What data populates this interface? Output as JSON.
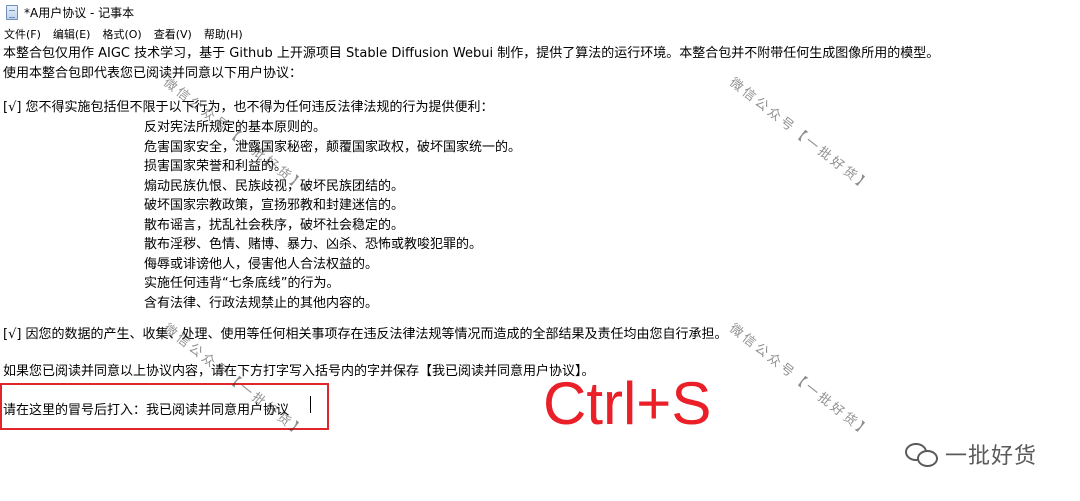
{
  "window": {
    "title": "*A用户协议 - 记事本"
  },
  "menu": [
    {
      "label": "文件(F)",
      "name": "file"
    },
    {
      "label": "编辑(E)",
      "name": "edit"
    },
    {
      "label": "格式(O)",
      "name": "format"
    },
    {
      "label": "查看(V)",
      "name": "view"
    },
    {
      "label": "帮助(H)",
      "name": "help"
    }
  ],
  "document": {
    "intro_1": "本整合包仅用作 AIGC 技术学习，基于 Github 上开源项目 Stable Diffusion Webui 制作，提供了算法的运行环境。本整合包并不附带任何生成图像所用的模型。",
    "intro_2": "使用本整合包即代表您已阅读并同意以下用户协议：",
    "clause_1_head": "[√] 您不得实施包括但不限于以下行为，也不得为任何违反法律法规的行为提供便利：",
    "clause_1_items": [
      "反对宪法所规定的基本原则的。",
      "危害国家安全，泄露国家秘密，颠覆国家政权，破坏国家统一的。",
      "损害国家荣誉和利益的。",
      "煽动民族仇恨、民族歧视，破坏民族团结的。",
      "破坏国家宗教政策，宣扬邪教和封建迷信的。",
      "散布谣言，扰乱社会秩序，破坏社会稳定的。",
      "散布淫秽、色情、赌博、暴力、凶杀、恐怖或教唆犯罪的。",
      "侮辱或诽谤他人，侵害他人合法权益的。",
      "实施任何违背“七条底线”的行为。",
      "含有法律、行政法规禁止的其他内容的。"
    ],
    "clause_2": "[√] 因您的数据的产生、收集、处理、使用等任何相关事项存在违反法律法规等情况而造成的全部结果及责任均由您自行承担。",
    "instruction": "如果您已阅读并同意以上协议内容，请在下方打字写入括号内的字并保存【我已阅读并同意用户协议】。",
    "input_line": "请在这里的冒号后打入：我已阅读并同意用户协议"
  },
  "overlay": {
    "shortcut_text": "Ctrl+S",
    "shortcut_color": "#ea1f27",
    "box_color": "#e0262b",
    "watermark_text": "微信公众号【一批好货】",
    "brand_text": "一批好货",
    "brand_icon": "wechat-icon"
  }
}
